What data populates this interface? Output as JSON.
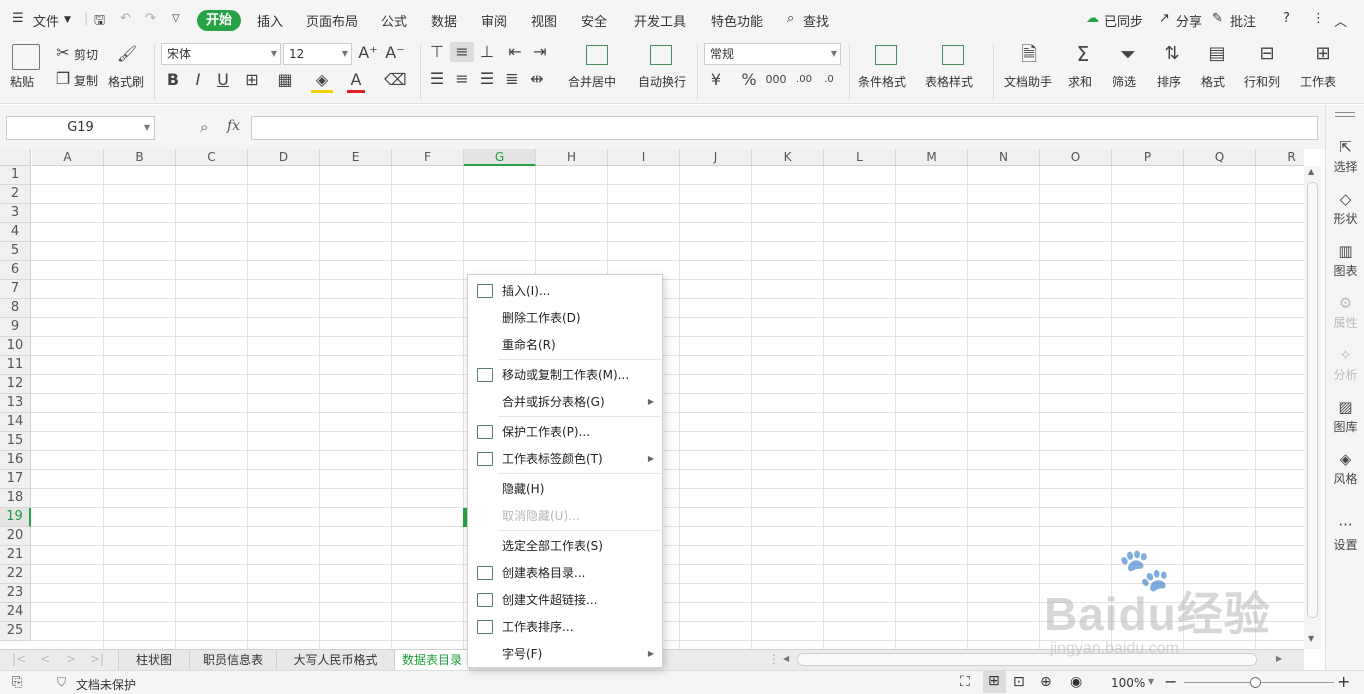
{
  "menubar": {
    "file_label": "文件",
    "tabs": [
      "开始",
      "插入",
      "页面布局",
      "公式",
      "数据",
      "审阅",
      "视图",
      "安全",
      "开发工具",
      "特色功能"
    ],
    "search_label": "查找",
    "sync_label": "已同步",
    "share_label": "分享",
    "comment_label": "批注"
  },
  "ribbon": {
    "paste": "粘贴",
    "cut": "剪切",
    "copy": "复制",
    "format_painter": "格式刷",
    "font_name": "宋体",
    "font_size": "12",
    "merge_center": "合并居中",
    "wrap_text": "自动换行",
    "number_format": "常规",
    "cond_format": "条件格式",
    "table_style": "表格样式",
    "doc_assistant": "文档助手",
    "sum": "求和",
    "filter": "筛选",
    "sort": "排序",
    "format": "格式",
    "row_col": "行和列",
    "worksheet": "工作表"
  },
  "formula_bar": {
    "cell_ref": "G19",
    "fx": "fx",
    "value": ""
  },
  "grid": {
    "columns": [
      "A",
      "B",
      "C",
      "D",
      "E",
      "F",
      "G",
      "H",
      "I",
      "J",
      "K",
      "L",
      "M",
      "N",
      "O",
      "P",
      "Q",
      "R"
    ],
    "rows": [
      "1",
      "2",
      "3",
      "4",
      "5",
      "6",
      "7",
      "8",
      "9",
      "10",
      "11",
      "12",
      "13",
      "14",
      "15",
      "16",
      "17",
      "18",
      "19",
      "20",
      "21",
      "22",
      "23",
      "24",
      "25"
    ],
    "active_column": "G",
    "active_row": "19"
  },
  "sidebar": {
    "items": [
      "选择",
      "形状",
      "图表",
      "属性",
      "分析",
      "图库",
      "风格",
      "设置"
    ]
  },
  "sheet_tabs": [
    "柱状图",
    "职员信息表",
    "大写人民币格式",
    "数据表目录"
  ],
  "active_sheet": "数据表目录",
  "context_menu": {
    "items": [
      "插入(I)...",
      "删除工作表(D)",
      "重命名(R)",
      "移动或复制工作表(M)...",
      "合并或拆分表格(G)",
      "保护工作表(P)...",
      "工作表标签颜色(T)",
      "隐藏(H)",
      "取消隐藏(U)...",
      "选定全部工作表(S)",
      "创建表格目录...",
      "创建文件超链接...",
      "工作表排序...",
      "字号(F)"
    ]
  },
  "statusbar": {
    "protect_label": "文档未保护",
    "zoom": "100%"
  },
  "watermark": {
    "brand": "Baidu经验",
    "url": "jingyan.baidu.com"
  },
  "colors": {
    "accent": "#27a244",
    "active_tab_text": "#1d9b3a"
  }
}
